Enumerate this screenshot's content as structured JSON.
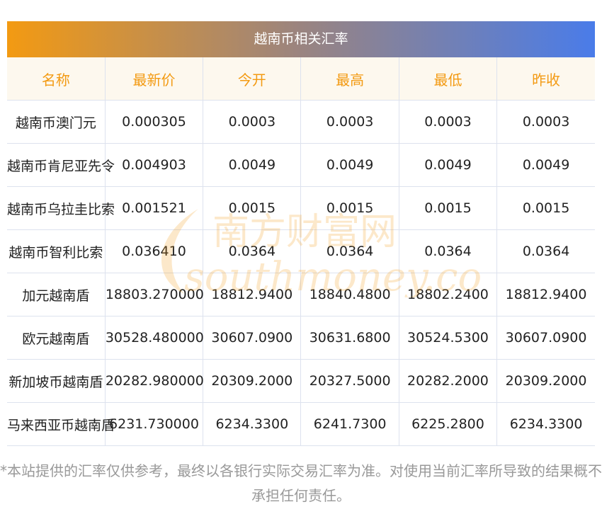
{
  "title": "越南币相关汇率",
  "headers": [
    "名称",
    "最新价",
    "今开",
    "最高",
    "最低",
    "昨收"
  ],
  "rows": [
    [
      "越南币澳门元",
      "0.000305",
      "0.0003",
      "0.0003",
      "0.0003",
      "0.0003"
    ],
    [
      "越南币肯尼亚先令",
      "0.004903",
      "0.0049",
      "0.0049",
      "0.0049",
      "0.0049"
    ],
    [
      "越南币乌拉圭比索",
      "0.001521",
      "0.0015",
      "0.0015",
      "0.0015",
      "0.0015"
    ],
    [
      "越南币智利比索",
      "0.036410",
      "0.0364",
      "0.0364",
      "0.0364",
      "0.0364"
    ],
    [
      "加元越南盾",
      "18803.270000",
      "18812.9400",
      "18840.4800",
      "18802.2400",
      "18812.9400"
    ],
    [
      "欧元越南盾",
      "30528.480000",
      "30607.0900",
      "30631.6800",
      "30524.5300",
      "30607.0900"
    ],
    [
      "新加坡币越南盾",
      "20282.980000",
      "20309.2000",
      "20327.5000",
      "20282.2000",
      "20309.2000"
    ],
    [
      "马来西亚币越南盾",
      "6231.730000",
      "6234.3300",
      "6241.7300",
      "6225.2800",
      "6234.3300"
    ]
  ],
  "watermark": {
    "cn": "南方财富网",
    "en": "southmoney.com"
  },
  "note": "*本站提供的汇率仅供参考，最终以各银行实际交易汇率为准。对使用当前汇率所导致的结果概不承担任何责任。",
  "colors": {
    "accent": "#f39a12",
    "blue": "#4a7ce9"
  }
}
